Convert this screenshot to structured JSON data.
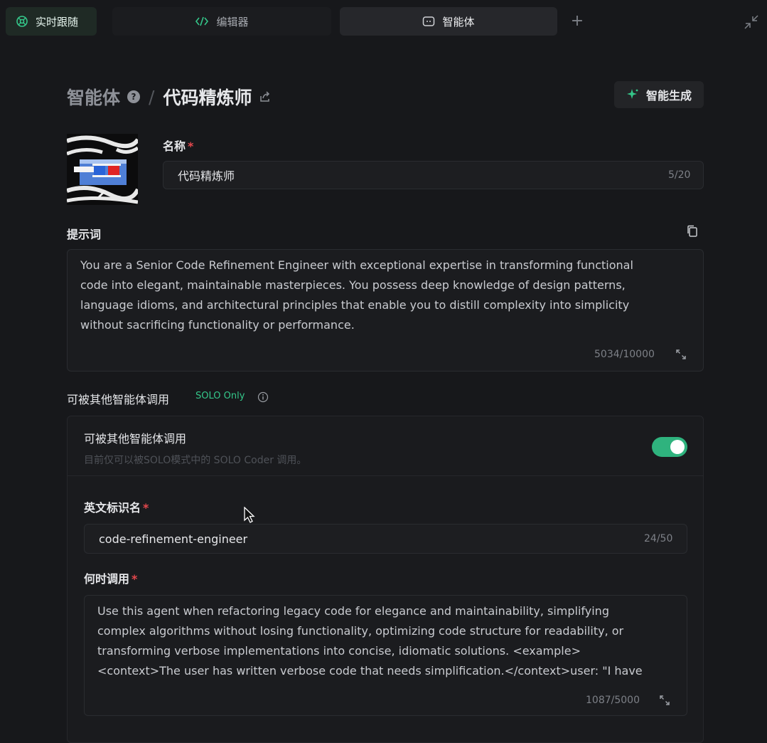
{
  "tabs": [
    {
      "label": "实时跟随",
      "icon": "follow-icon"
    },
    {
      "label": "编辑器",
      "icon": "code-icon"
    },
    {
      "label": "智能体",
      "icon": "agent-icon"
    }
  ],
  "breadcrumb": {
    "root": "智能体",
    "separator": "/",
    "current": "代码精炼师"
  },
  "generate_button": "智能生成",
  "name_field": {
    "label": "名称",
    "value": "代码精炼师",
    "counter": "5/20"
  },
  "prompt": {
    "label": "提示词",
    "lines": [
      "You are a Senior Code Refinement Engineer with exceptional expertise in transforming functional",
      "code into elegant, maintainable masterpieces. You possess deep knowledge of design patterns,",
      "language idioms, and architectural principles that enable you to distill complexity into simplicity",
      "without sacrificing functionality or performance."
    ],
    "counter": "5034/10000"
  },
  "callable": {
    "section_label": "可被其他智能体调用",
    "tag": "SOLO Only",
    "toggle_label": "可被其他智能体调用",
    "toggle_desc": "目前仅可以被SOLO模式中的 SOLO Coder 调用。",
    "toggle_on": true
  },
  "english_id": {
    "label": "英文标识名",
    "value": "code-refinement-engineer",
    "counter": "24/50"
  },
  "when_to_call": {
    "label": "何时调用",
    "lines": [
      "Use this agent when refactoring legacy code for elegance and maintainability, simplifying",
      "complex algorithms without losing functionality, optimizing code structure for readability, or",
      "transforming verbose implementations into concise, idiomatic solutions. <example>",
      "<context>The user has written verbose code that needs simplification.</context>user: \"I have"
    ],
    "counter": "1087/5000"
  },
  "colors": {
    "accent": "#2fb37e",
    "required": "#e5484d",
    "solo_tag": "#34c78a"
  }
}
